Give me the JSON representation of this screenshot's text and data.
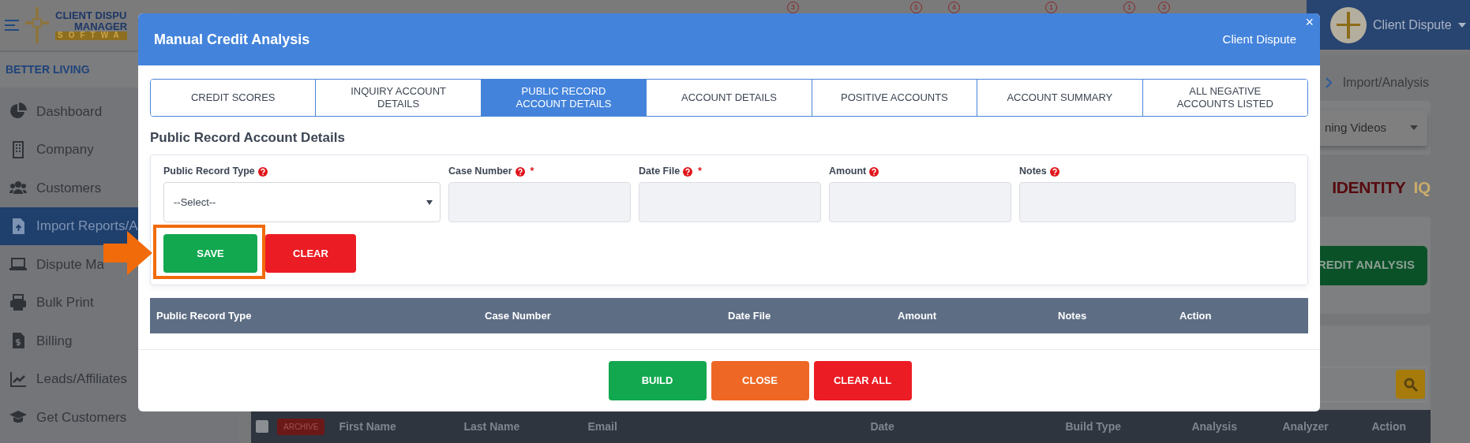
{
  "brand": {
    "lines": [
      "CLIENT DISPU",
      "MANAGER",
      "SOFTWA"
    ]
  },
  "company": "BETTER LIVING",
  "sidebar": [
    {
      "label": "Dashboard",
      "selected": false
    },
    {
      "label": "Company",
      "selected": false
    },
    {
      "label": "Customers",
      "selected": false
    },
    {
      "label": "Import Reports/A",
      "selected": true
    },
    {
      "label": "Dispute Ma",
      "selected": false
    },
    {
      "label": "Bulk Print",
      "selected": false
    },
    {
      "label": "Billing",
      "selected": false
    },
    {
      "label": "Leads/Affiliates",
      "selected": false
    },
    {
      "label": "Get Customers",
      "selected": false
    }
  ],
  "notification_badges": [
    "3",
    "5",
    "4",
    "1",
    "1",
    "3"
  ],
  "user_menu": {
    "name": "Client Dispute"
  },
  "breadcrumb": {
    "current": "Import/Analysis"
  },
  "videos_dropdown": {
    "label": "ning Videos"
  },
  "provider_title": [
    "IDENTITY",
    "IQ"
  ],
  "analysis_button": "REDIT ANALYSIS",
  "customers_table": {
    "archive_button": "ARCHIVE",
    "select_all_checked": false,
    "columns": [
      "First Name",
      "Last Name",
      "Email",
      "Date",
      "Build Type",
      "Analysis",
      "Analyzer",
      "Action"
    ]
  },
  "modal": {
    "title": "Manual Credit Analysis",
    "subtitle": "Client Dispute",
    "close": "×",
    "tabs": [
      {
        "label": "CREDIT SCORES",
        "selected": false
      },
      {
        "label": "INQUIRY ACCOUNT DETAILS",
        "selected": false
      },
      {
        "label": "PUBLIC RECORD ACCOUNT DETAILS",
        "selected": true
      },
      {
        "label": "ACCOUNT DETAILS",
        "selected": false
      },
      {
        "label": "POSITIVE ACCOUNTS",
        "selected": false
      },
      {
        "label": "ACCOUNT SUMMARY",
        "selected": false
      },
      {
        "label": "ALL NEGATIVE ACCOUNTS LISTED",
        "selected": false
      }
    ],
    "section_title": "Public Record Account Details",
    "fields": [
      {
        "label": "Public Record Type",
        "kind": "select",
        "value": "--Select--"
      },
      {
        "label": "Case Number",
        "kind": "text",
        "required_mark": "*"
      },
      {
        "label": "Date File",
        "kind": "text",
        "required_mark": "*"
      },
      {
        "label": "Amount",
        "kind": "text"
      },
      {
        "label": "Notes",
        "kind": "text"
      }
    ],
    "form_buttons": [
      {
        "label": "SAVE",
        "kind": "save",
        "highlighted": true
      },
      {
        "label": "CLEAR",
        "kind": "clear",
        "highlighted": false
      }
    ],
    "table": {
      "columns": [
        "Public Record Type",
        "Case Number",
        "Date File",
        "Amount",
        "Notes",
        "Action"
      ]
    },
    "footer_buttons": [
      {
        "label": "BUILD",
        "kind": "build"
      },
      {
        "label": "CLOSE",
        "kind": "close"
      },
      {
        "label": "CLEAR ALL",
        "kind": "clear"
      }
    ]
  }
}
